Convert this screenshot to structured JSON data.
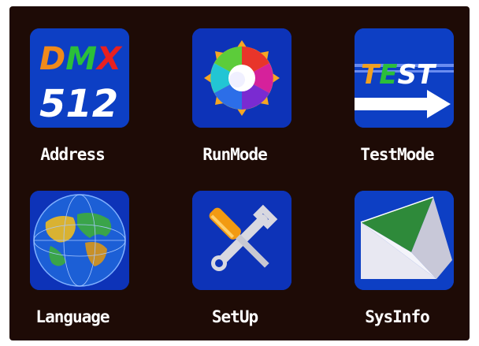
{
  "menu": {
    "items": [
      {
        "id": "address",
        "label": "Address",
        "icon": "dmx-512-icon",
        "icon_text_top": "DMX",
        "icon_text_bottom": "512"
      },
      {
        "id": "runmode",
        "label": "RunMode",
        "icon": "color-wheel-icon"
      },
      {
        "id": "testmode",
        "label": "TestMode",
        "icon": "test-arrow-icon",
        "icon_text": "TEST"
      },
      {
        "id": "language",
        "label": "Language",
        "icon": "globe-icon"
      },
      {
        "id": "setup",
        "label": "SetUp",
        "icon": "wrench-screwdriver-icon"
      },
      {
        "id": "sysinfo",
        "label": "SysInfo",
        "icon": "envelope-icon"
      }
    ]
  },
  "colors": {
    "screen_bg": "#1e0b06",
    "icon_bg": "#0d33b8",
    "label": "#ffffff"
  }
}
